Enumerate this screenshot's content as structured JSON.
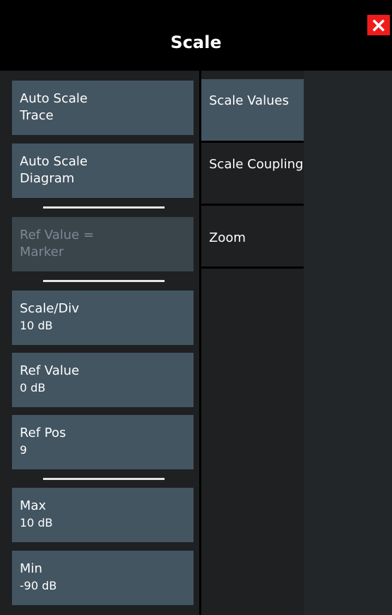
{
  "dialog": {
    "title": "Scale"
  },
  "left_buttons": {
    "auto_scale_trace": {
      "line1": "Auto Scale",
      "line2": "Trace"
    },
    "auto_scale_diagram": {
      "line1": "Auto Scale",
      "line2": "Diagram"
    },
    "ref_value_marker": {
      "line1": "Ref Value =",
      "line2": "Marker"
    },
    "scale_div": {
      "line1": "Scale/Div",
      "line2": "10 dB"
    },
    "ref_value": {
      "line1": "Ref Value",
      "line2": "0 dB"
    },
    "ref_pos": {
      "line1": "Ref Pos",
      "line2": "9"
    },
    "max": {
      "line1": "Max",
      "line2": "10 dB"
    },
    "min": {
      "line1": "Min",
      "line2": "-90 dB"
    }
  },
  "tabs": [
    {
      "line1": "Scale",
      "line2": "Values",
      "active": true
    },
    {
      "line1": "Scale",
      "line2": "Coupling",
      "active": false
    },
    {
      "line1": "Zoom",
      "line2": "",
      "active": false
    }
  ],
  "colors": {
    "button_bg": "#435561",
    "active_tab_bg": "#435561",
    "close_bg": "#ee1c1c"
  }
}
